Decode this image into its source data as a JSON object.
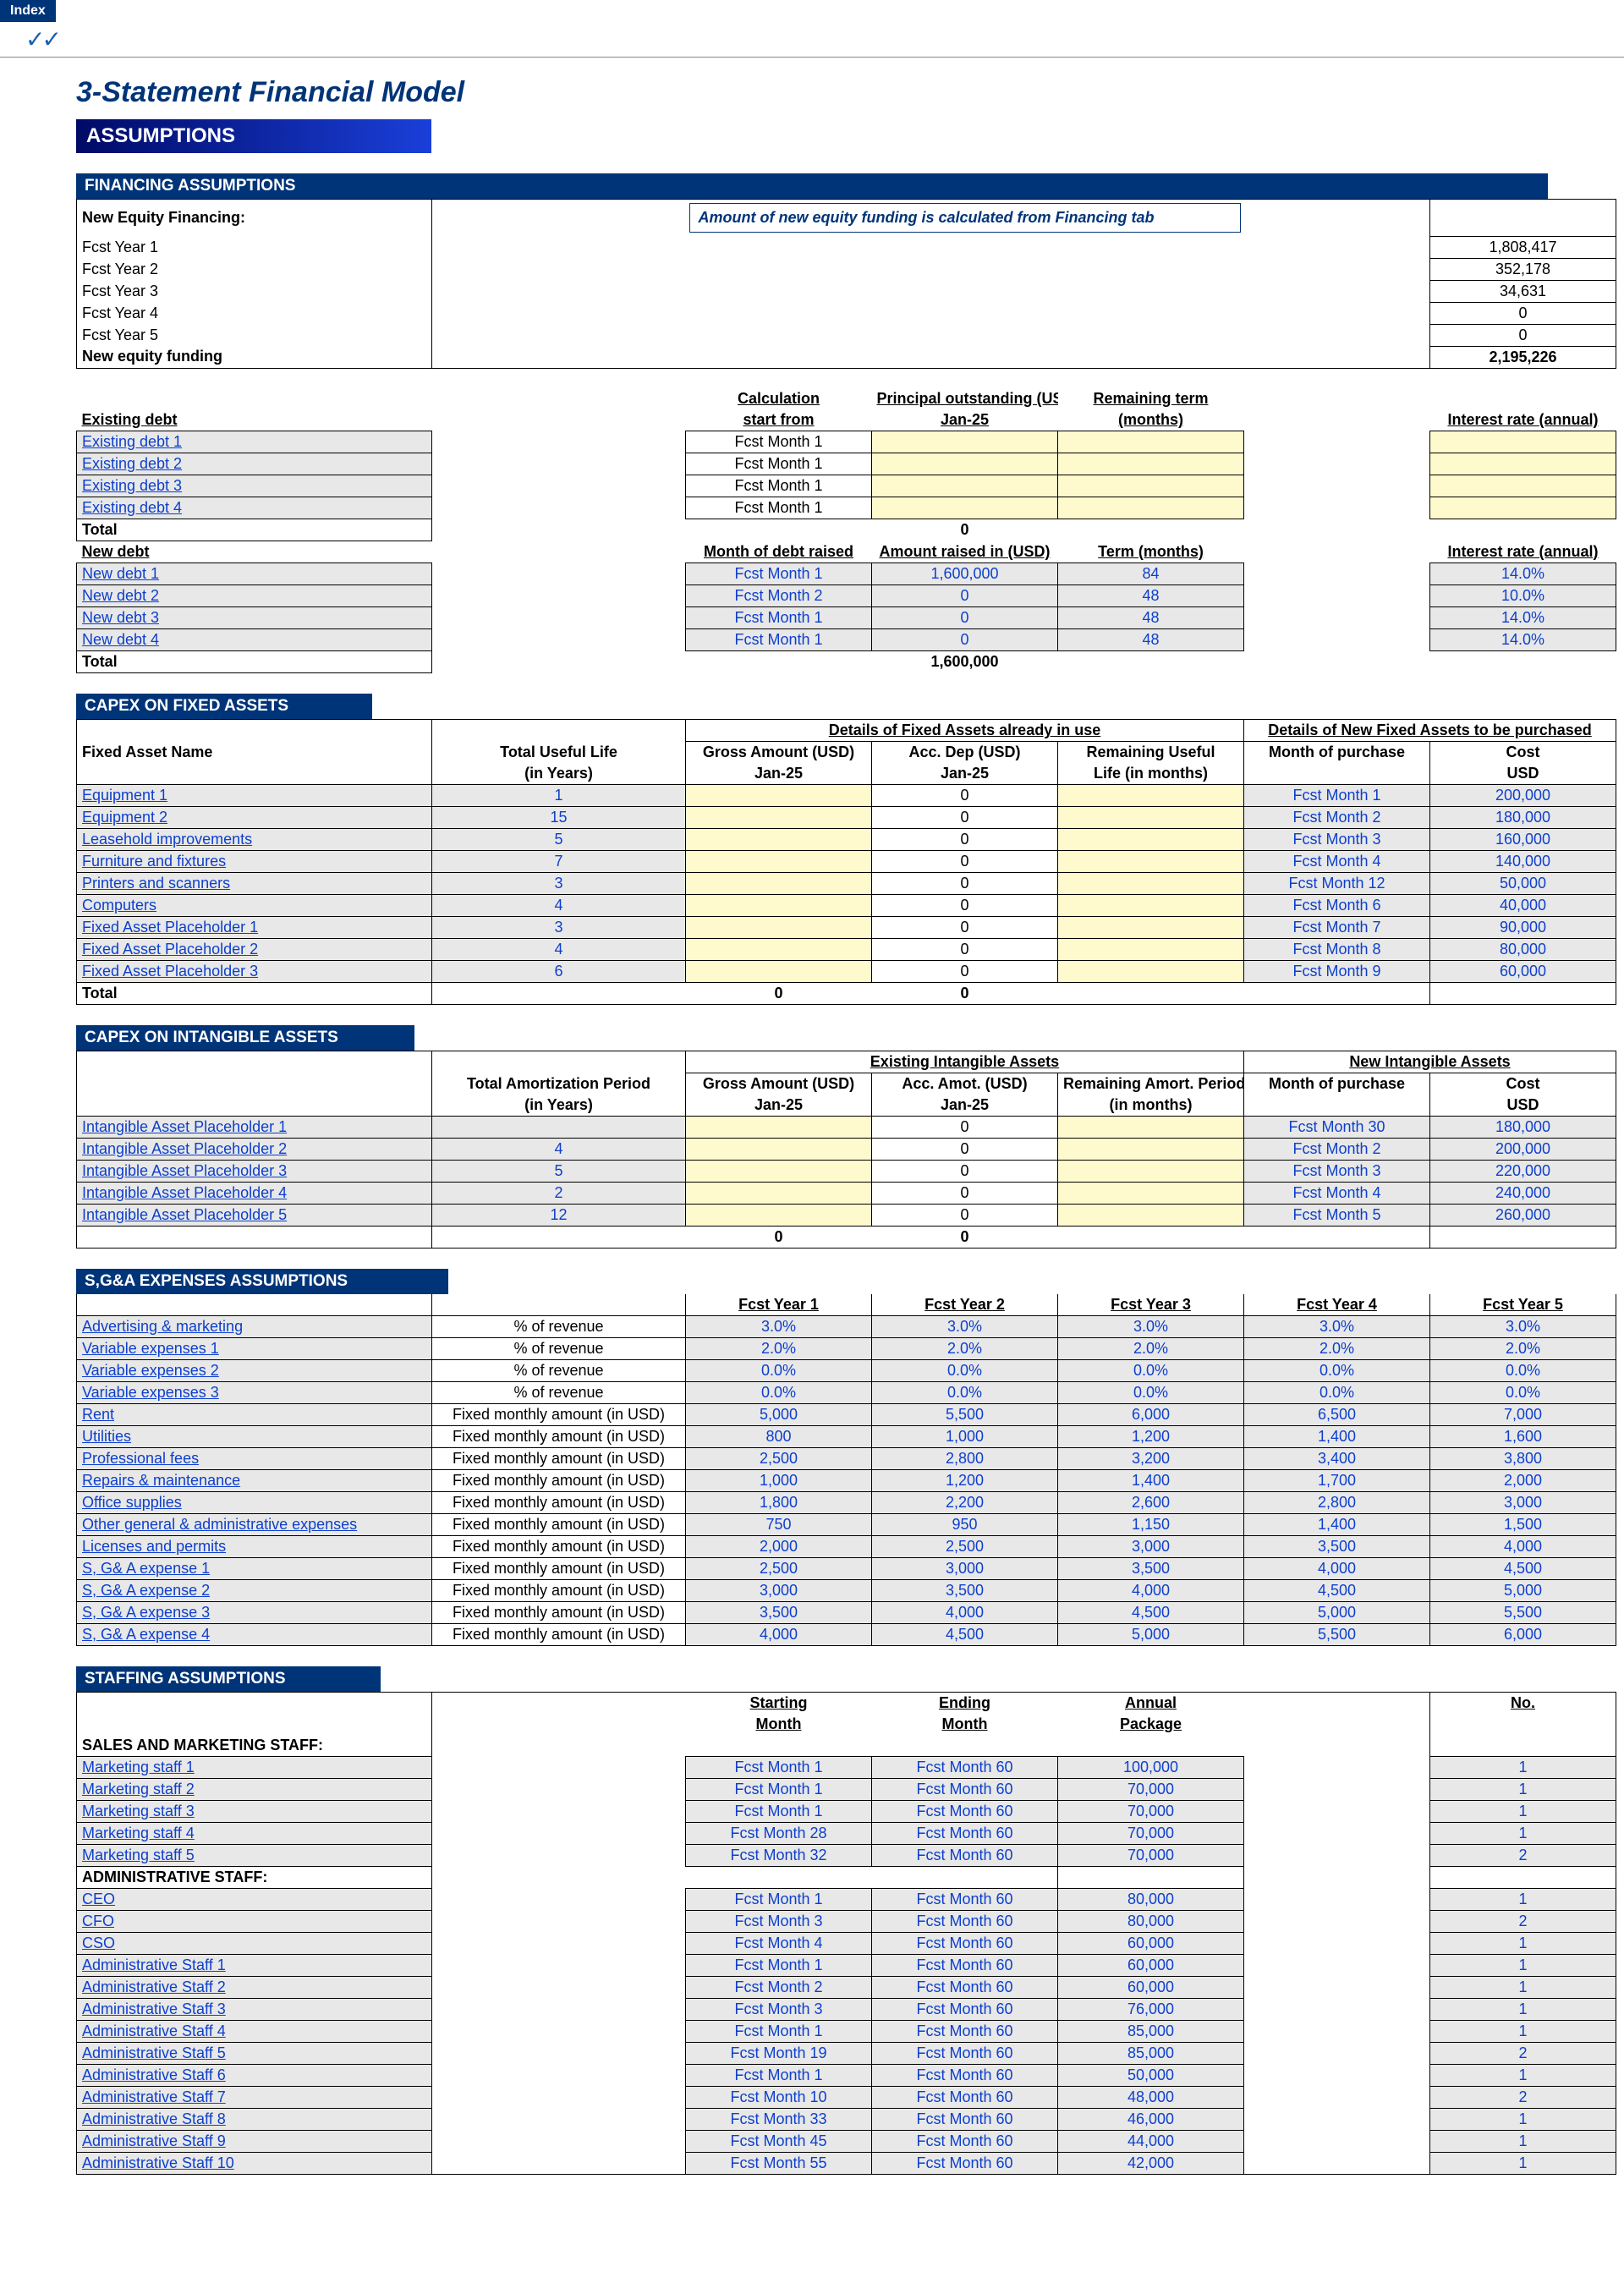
{
  "ui": {
    "index_tab": "Index",
    "title": "3-Statement Financial Model",
    "assumptions": "ASSUMPTIONS"
  },
  "financing": {
    "header": "FINANCING ASSUMPTIONS",
    "new_equity_label": "New Equity Financing:",
    "note": "Amount of new equity funding is calculated from Financing  tab",
    "years": [
      {
        "label": "Fcst Year 1",
        "value": "1,808,417"
      },
      {
        "label": "Fcst Year 2",
        "value": "352,178"
      },
      {
        "label": "Fcst Year 3",
        "value": "34,631"
      },
      {
        "label": "Fcst Year 4",
        "value": "0"
      },
      {
        "label": "Fcst Year 5",
        "value": "0"
      }
    ],
    "new_equity_funding_label": "New equity funding",
    "new_equity_funding_value": "2,195,226",
    "existing_debt_headers": {
      "label": "Existing debt",
      "calc": "Calculation start from",
      "principal": "Principal outstanding (USD)",
      "principal_date": "Jan-25",
      "term": "Remaining term (months)",
      "rate": "Interest rate (annual)"
    },
    "existing_debt": [
      {
        "name": "Existing debt 1",
        "calc": "Fcst Month 1"
      },
      {
        "name": "Existing debt 2",
        "calc": "Fcst Month 1"
      },
      {
        "name": "Existing debt 3",
        "calc": "Fcst Month 1"
      },
      {
        "name": "Existing debt 4",
        "calc": "Fcst Month 1"
      }
    ],
    "existing_total_label": "Total",
    "existing_total_value": "0",
    "new_debt_label": "New debt",
    "new_debt_headers": {
      "month": "Month of debt raised",
      "amount": "Amount raised in (USD)",
      "term": "Term (months)",
      "rate": "Interest rate (annual)"
    },
    "new_debt": [
      {
        "name": "New debt 1",
        "month": "Fcst Month 1",
        "amount": "1,600,000",
        "term": "84",
        "rate": "14.0%"
      },
      {
        "name": "New debt 2",
        "month": "Fcst Month 2",
        "amount": "0",
        "term": "48",
        "rate": "10.0%"
      },
      {
        "name": "New debt 3",
        "month": "Fcst Month 1",
        "amount": "0",
        "term": "48",
        "rate": "14.0%"
      },
      {
        "name": "New debt 4",
        "month": "Fcst Month 1",
        "amount": "0",
        "term": "48",
        "rate": "14.0%"
      }
    ],
    "new_debt_total_label": "Total",
    "new_debt_total_value": "1,600,000"
  },
  "capex_fixed": {
    "header": "CAPEX ON FIXED ASSETS",
    "col_headers": {
      "name": "Fixed Asset Name",
      "life": "Total Useful Life (in Years)",
      "existing_group": "Details of Fixed Assets already in use",
      "new_group": "Details of New Fixed Assets to be purchased",
      "gross": "Gross Amount (USD)",
      "gross_date": "Jan-25",
      "acc": "Acc. Dep (USD)",
      "acc_date": "Jan-25",
      "remain": "Remaining Useful Life (in months)",
      "mop": "Month of purchase",
      "cost": "Cost",
      "cost_unit": "USD"
    },
    "rows": [
      {
        "name": "Equipment 1",
        "life": "1",
        "acc": "0",
        "mop": "Fcst Month 1",
        "cost": "200,000"
      },
      {
        "name": "Equipment 2",
        "life": "15",
        "acc": "0",
        "mop": "Fcst Month 2",
        "cost": "180,000"
      },
      {
        "name": "Leasehold improvements",
        "life": "5",
        "acc": "0",
        "mop": "Fcst Month 3",
        "cost": "160,000"
      },
      {
        "name": "Furniture and fixtures",
        "life": "7",
        "acc": "0",
        "mop": "Fcst Month 4",
        "cost": "140,000"
      },
      {
        "name": "Printers and scanners",
        "life": "3",
        "acc": "0",
        "mop": "Fcst Month 12",
        "cost": "50,000"
      },
      {
        "name": "Computers",
        "life": "4",
        "acc": "0",
        "mop": "Fcst Month 6",
        "cost": "40,000"
      },
      {
        "name": "Fixed Asset Placeholder 1",
        "life": "3",
        "acc": "0",
        "mop": "Fcst Month 7",
        "cost": "90,000"
      },
      {
        "name": "Fixed Asset Placeholder 2",
        "life": "4",
        "acc": "0",
        "mop": "Fcst Month 8",
        "cost": "80,000"
      },
      {
        "name": "Fixed Asset Placeholder 3",
        "life": "6",
        "acc": "0",
        "mop": "Fcst Month 9",
        "cost": "60,000"
      }
    ],
    "total_label": "Total",
    "total_gross": "0",
    "total_acc": "0"
  },
  "capex_intangible": {
    "header": "CAPEX ON INTANGIBLE ASSETS",
    "col_headers": {
      "life": "Total Amortization Period (in Years)",
      "existing_group": "Existing Intangible Assets",
      "new_group": "New Intangible Assets",
      "gross": "Gross Amount (USD)",
      "gross_date": "Jan-25",
      "acc": "Acc. Amot. (USD)",
      "acc_date": "Jan-25",
      "remain": "Remaining Amort. Period (in months)",
      "mop": "Month of purchase",
      "cost": "Cost",
      "cost_unit": "USD"
    },
    "rows": [
      {
        "name": "Intangible Asset Placeholder 1",
        "life": "",
        "acc": "0",
        "mop": "Fcst Month 30",
        "cost": "180,000"
      },
      {
        "name": "Intangible Asset Placeholder 2",
        "life": "4",
        "acc": "0",
        "mop": "Fcst Month 2",
        "cost": "200,000"
      },
      {
        "name": "Intangible Asset Placeholder 3",
        "life": "5",
        "acc": "0",
        "mop": "Fcst Month 3",
        "cost": "220,000"
      },
      {
        "name": "Intangible Asset Placeholder 4",
        "life": "2",
        "acc": "0",
        "mop": "Fcst Month 4",
        "cost": "240,000"
      },
      {
        "name": "Intangible Asset Placeholder 5",
        "life": "12",
        "acc": "0",
        "mop": "Fcst Month 5",
        "cost": "260,000"
      }
    ],
    "total_gross": "0",
    "total_acc": "0"
  },
  "sga": {
    "header": "S,G&A EXPENSES ASSUMPTIONS",
    "year_headers": [
      "Fcst Year 1",
      "Fcst Year 2",
      "Fcst Year 3",
      "Fcst Year 4",
      "Fcst Year 5"
    ],
    "rows": [
      {
        "name": "Advertising & marketing",
        "type": "% of revenue",
        "v": [
          "3.0%",
          "3.0%",
          "3.0%",
          "3.0%",
          "3.0%"
        ]
      },
      {
        "name": "Variable expenses 1",
        "type": "% of revenue",
        "v": [
          "2.0%",
          "2.0%",
          "2.0%",
          "2.0%",
          "2.0%"
        ]
      },
      {
        "name": "Variable expenses 2",
        "type": "% of revenue",
        "v": [
          "0.0%",
          "0.0%",
          "0.0%",
          "0.0%",
          "0.0%"
        ]
      },
      {
        "name": "Variable expenses 3",
        "type": "% of revenue",
        "v": [
          "0.0%",
          "0.0%",
          "0.0%",
          "0.0%",
          "0.0%"
        ]
      },
      {
        "name": "Rent",
        "type": "Fixed monthly amount (in USD)",
        "v": [
          "5,000",
          "5,500",
          "6,000",
          "6,500",
          "7,000"
        ]
      },
      {
        "name": "Utilities",
        "type": "Fixed monthly amount (in USD)",
        "v": [
          "800",
          "1,000",
          "1,200",
          "1,400",
          "1,600"
        ]
      },
      {
        "name": "Professional fees",
        "type": "Fixed monthly amount (in USD)",
        "v": [
          "2,500",
          "2,800",
          "3,200",
          "3,400",
          "3,800"
        ]
      },
      {
        "name": "Repairs & maintenance",
        "type": "Fixed monthly amount (in USD)",
        "v": [
          "1,000",
          "1,200",
          "1,400",
          "1,700",
          "2,000"
        ]
      },
      {
        "name": "Office supplies",
        "type": "Fixed monthly amount (in USD)",
        "v": [
          "1,800",
          "2,200",
          "2,600",
          "2,800",
          "3,000"
        ]
      },
      {
        "name": "Other general & administrative expenses",
        "type": "Fixed monthly amount (in USD)",
        "v": [
          "750",
          "950",
          "1,150",
          "1,400",
          "1,500"
        ]
      },
      {
        "name": "Licenses and permits",
        "type": "Fixed monthly amount (in USD)",
        "v": [
          "2,000",
          "2,500",
          "3,000",
          "3,500",
          "4,000"
        ]
      },
      {
        "name": "S, G& A expense 1",
        "type": "Fixed monthly amount (in USD)",
        "v": [
          "2,500",
          "3,000",
          "3,500",
          "4,000",
          "4,500"
        ]
      },
      {
        "name": "S, G& A expense 2",
        "type": "Fixed monthly amount (in USD)",
        "v": [
          "3,000",
          "3,500",
          "4,000",
          "4,500",
          "5,000"
        ]
      },
      {
        "name": "S, G& A expense 3",
        "type": "Fixed monthly amount (in USD)",
        "v": [
          "3,500",
          "4,000",
          "4,500",
          "5,000",
          "5,500"
        ]
      },
      {
        "name": "S, G& A expense 4",
        "type": "Fixed monthly amount (in USD)",
        "v": [
          "4,000",
          "4,500",
          "5,000",
          "5,500",
          "6,000"
        ]
      }
    ]
  },
  "staffing": {
    "header": "STAFFING ASSUMPTIONS",
    "col_headers": {
      "start": "Starting Month",
      "end": "Ending Month",
      "pkg": "Annual Package",
      "no": "No."
    },
    "sales_label": "SALES AND MARKETING STAFF:",
    "sales": [
      {
        "name": "Marketing staff 1",
        "start": "Fcst Month 1",
        "end": "Fcst Month 60",
        "pkg": "100,000",
        "no": "1"
      },
      {
        "name": "Marketing staff 2",
        "start": "Fcst Month 1",
        "end": "Fcst Month 60",
        "pkg": "70,000",
        "no": "1"
      },
      {
        "name": "Marketing staff 3",
        "start": "Fcst Month 1",
        "end": "Fcst Month 60",
        "pkg": "70,000",
        "no": "1"
      },
      {
        "name": "Marketing staff 4",
        "start": "Fcst Month 28",
        "end": "Fcst Month 60",
        "pkg": "70,000",
        "no": "1"
      },
      {
        "name": "Marketing staff 5",
        "start": "Fcst Month 32",
        "end": "Fcst Month 60",
        "pkg": "70,000",
        "no": "2"
      }
    ],
    "admin_label": "ADMINISTRATIVE STAFF:",
    "admin": [
      {
        "name": "CEO",
        "start": "Fcst Month 1",
        "end": "Fcst Month 60",
        "pkg": "80,000",
        "no": "1"
      },
      {
        "name": "CFO",
        "start": "Fcst Month 3",
        "end": "Fcst Month 60",
        "pkg": "80,000",
        "no": "2"
      },
      {
        "name": "CSO",
        "start": "Fcst Month 4",
        "end": "Fcst Month 60",
        "pkg": "60,000",
        "no": "1"
      },
      {
        "name": "Administrative Staff 1",
        "start": "Fcst Month 1",
        "end": "Fcst Month 60",
        "pkg": "60,000",
        "no": "1"
      },
      {
        "name": "Administrative Staff 2",
        "start": "Fcst Month 2",
        "end": "Fcst Month 60",
        "pkg": "60,000",
        "no": "1"
      },
      {
        "name": "Administrative Staff 3",
        "start": "Fcst Month 3",
        "end": "Fcst Month 60",
        "pkg": "76,000",
        "no": "1"
      },
      {
        "name": "Administrative Staff 4",
        "start": "Fcst Month 1",
        "end": "Fcst Month 60",
        "pkg": "85,000",
        "no": "1"
      },
      {
        "name": "Administrative Staff 5",
        "start": "Fcst Month 19",
        "end": "Fcst Month 60",
        "pkg": "85,000",
        "no": "2"
      },
      {
        "name": "Administrative Staff 6",
        "start": "Fcst Month 1",
        "end": "Fcst Month 60",
        "pkg": "50,000",
        "no": "1"
      },
      {
        "name": "Administrative Staff 7",
        "start": "Fcst Month 10",
        "end": "Fcst Month 60",
        "pkg": "48,000",
        "no": "2"
      },
      {
        "name": "Administrative Staff 8",
        "start": "Fcst Month 33",
        "end": "Fcst Month 60",
        "pkg": "46,000",
        "no": "1"
      },
      {
        "name": "Administrative Staff 9",
        "start": "Fcst Month 45",
        "end": "Fcst Month 60",
        "pkg": "44,000",
        "no": "1"
      },
      {
        "name": "Administrative Staff 10",
        "start": "Fcst Month 55",
        "end": "Fcst Month 60",
        "pkg": "42,000",
        "no": "1"
      }
    ]
  }
}
